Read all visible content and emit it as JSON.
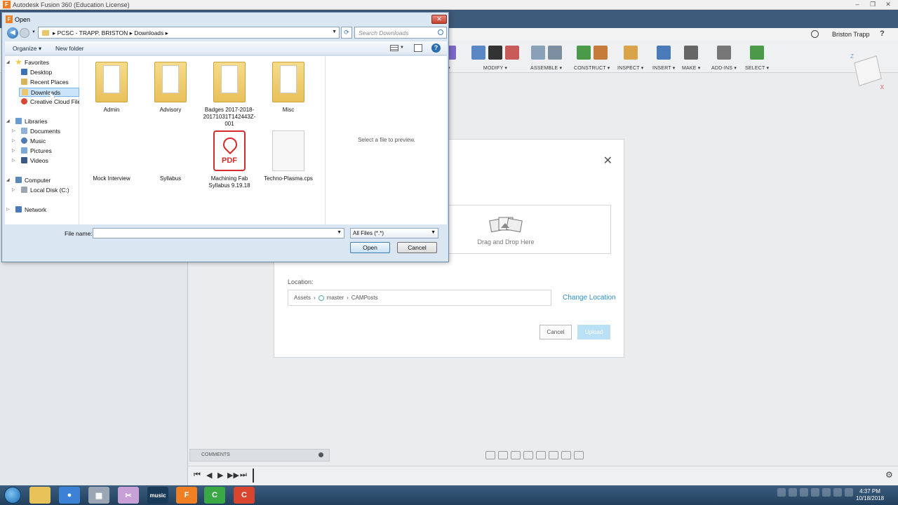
{
  "app": {
    "title": "Autodesk Fusion 360 (Education License)",
    "icon_letter": "F",
    "user": "Briston Trapp",
    "help": "?",
    "window_controls": [
      "–",
      "❐",
      "✕"
    ]
  },
  "toolbar": {
    "groups": [
      {
        "label": "▾",
        "icons": [
          "#7b68c8"
        ]
      },
      {
        "label": "MODIFY ▾",
        "icons": [
          "#5b87c5",
          "#333333",
          "#c85a5a"
        ]
      },
      {
        "label": "ASSEMBLE ▾",
        "icons": [
          "#8aa0b8",
          "#7c8ea0"
        ]
      },
      {
        "label": "CONSTRUCT ▾",
        "icons": [
          "#4a9a4a",
          "#c77b3a"
        ]
      },
      {
        "label": "INSPECT ▾",
        "icons": [
          "#d9a34a"
        ]
      },
      {
        "label": "INSERT ▾",
        "icons": [
          "#4a7ab8"
        ]
      },
      {
        "label": "MAKE ▾",
        "icons": [
          "#666666"
        ]
      },
      {
        "label": "ADD-INS ▾",
        "icons": [
          "#777777"
        ]
      },
      {
        "label": "SELECT ▾",
        "icons": [
          "#4a9a4a"
        ]
      }
    ]
  },
  "viewcube": {
    "z": "Z",
    "x": "X"
  },
  "upload_dialog": {
    "close": "✕",
    "drop_text": "Drag and Drop Here",
    "location_label": "Location:",
    "location_path": [
      "Assets",
      "master",
      "CAMPosts"
    ],
    "change_location": "Change Location",
    "cancel": "Cancel",
    "upload": "Upload"
  },
  "bottom": {
    "comments": "COMMENTS",
    "timeline_controls": [
      "⏮",
      "◀",
      "▶",
      "▶▶",
      "⏭"
    ],
    "gear": "⚙"
  },
  "taskbar": {
    "apps": [
      {
        "name": "explorer",
        "color": "#e8c35a",
        "label": ""
      },
      {
        "name": "chrome",
        "color": "#3b82d6",
        "label": "●"
      },
      {
        "name": "calculator",
        "color": "#9aa6b3",
        "label": "▦"
      },
      {
        "name": "snipping",
        "color": "#c8a0d8",
        "label": "✂"
      },
      {
        "name": "music",
        "color": "#1a3a5a",
        "label": "music"
      },
      {
        "name": "fusion",
        "color": "#f07e22",
        "label": "F"
      },
      {
        "name": "camtasia-green",
        "color": "#3aa845",
        "label": "C"
      },
      {
        "name": "camtasia-red",
        "color": "#d9452e",
        "label": "C"
      }
    ],
    "time": "4:37 PM",
    "date": "10/18/2018"
  },
  "open_dialog": {
    "title": "Open",
    "close": "✕",
    "breadcrumb": "▸  PCSC - TRAPP, BRISTON  ▸  Downloads  ▸",
    "search_placeholder": "Search Downloads",
    "organize": "Organize ▾",
    "new_folder": "New folder",
    "help": "?",
    "nav": {
      "favorites": "Favorites",
      "desktop": "Desktop",
      "recent": "Recent Places",
      "downloads": "Downloads",
      "cc_files": "Creative Cloud Files",
      "libraries": "Libraries",
      "documents": "Documents",
      "music": "Music",
      "pictures": "Pictures",
      "videos": "Videos",
      "computer": "Computer",
      "local_disk": "Local Disk (C:)",
      "network": "Network"
    },
    "files": [
      {
        "name": "Admin",
        "kind": "folder"
      },
      {
        "name": "Advisory",
        "kind": "folder"
      },
      {
        "name": "Badges 2017-2018-20171031T142443Z-001",
        "kind": "folder"
      },
      {
        "name": "Misc",
        "kind": "folder"
      },
      {
        "name": "Mock Interview",
        "kind": "none"
      },
      {
        "name": "Syllabus",
        "kind": "none"
      },
      {
        "name": "Machining Fab Syllabus 9.19.18",
        "kind": "pdf"
      },
      {
        "name": "Techno-Plasma.cps",
        "kind": "blank"
      }
    ],
    "pdf_label": "PDF",
    "preview_text": "Select a file to preview.",
    "file_name_label": "File name:",
    "file_name_value": "",
    "file_type": "All Files (*.*)",
    "open": "Open",
    "cancel": "Cancel"
  }
}
